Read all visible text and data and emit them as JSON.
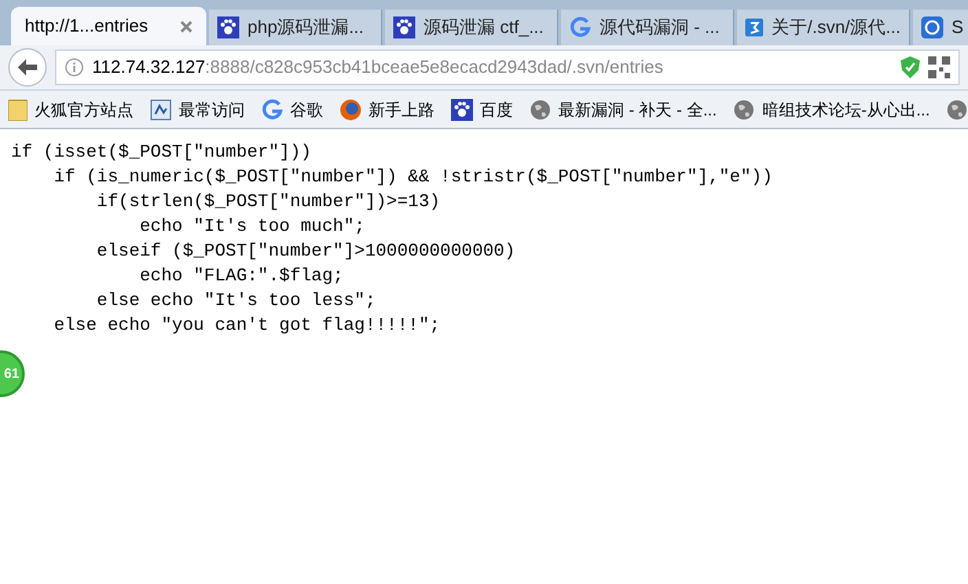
{
  "tabs": [
    {
      "label": "http://1...entries",
      "kind": "plain",
      "selected": true
    },
    {
      "label": "php源码泄漏...",
      "kind": "paw",
      "selected": false
    },
    {
      "label": "源码泄漏 ctf_...",
      "kind": "paw",
      "selected": false
    },
    {
      "label": "源代码漏洞 - ...",
      "kind": "google",
      "selected": false
    },
    {
      "label": "关于/.svn/源代...",
      "kind": "three",
      "selected": false
    },
    {
      "label": "S",
      "kind": "swirl",
      "selected": false
    }
  ],
  "address_bar": {
    "host": "112.74.32.127",
    "path": ":8888/c828c953cb41bceae5e8ecacd2943dad/.svn/entries"
  },
  "bookmarks": [
    {
      "label": "火狐官方站点",
      "kind": "folder"
    },
    {
      "label": "最常访问",
      "kind": "doc"
    },
    {
      "label": "谷歌",
      "kind": "google"
    },
    {
      "label": "新手上路",
      "kind": "firefox"
    },
    {
      "label": "百度",
      "kind": "paw"
    },
    {
      "label": "最新漏洞 - 补天 - 全...",
      "kind": "globe"
    },
    {
      "label": "暗组技术论坛-从心出...",
      "kind": "globe"
    },
    {
      "kind": "globe"
    }
  ],
  "code_lines": [
    "if (isset($_POST[\"number\"]))",
    "    if (is_numeric($_POST[\"number\"]) && !stristr($_POST[\"number\"],\"e\"))",
    "        if(strlen($_POST[\"number\"])>=13)",
    "            echo \"It's too much\";",
    "        elseif ($_POST[\"number\"]>1000000000000)",
    "            echo \"FLAG:\".$flag;",
    "        else echo \"It's too less\";",
    "    else echo \"you can't got flag!!!!!\";"
  ],
  "floating_badge": {
    "text": "61"
  }
}
